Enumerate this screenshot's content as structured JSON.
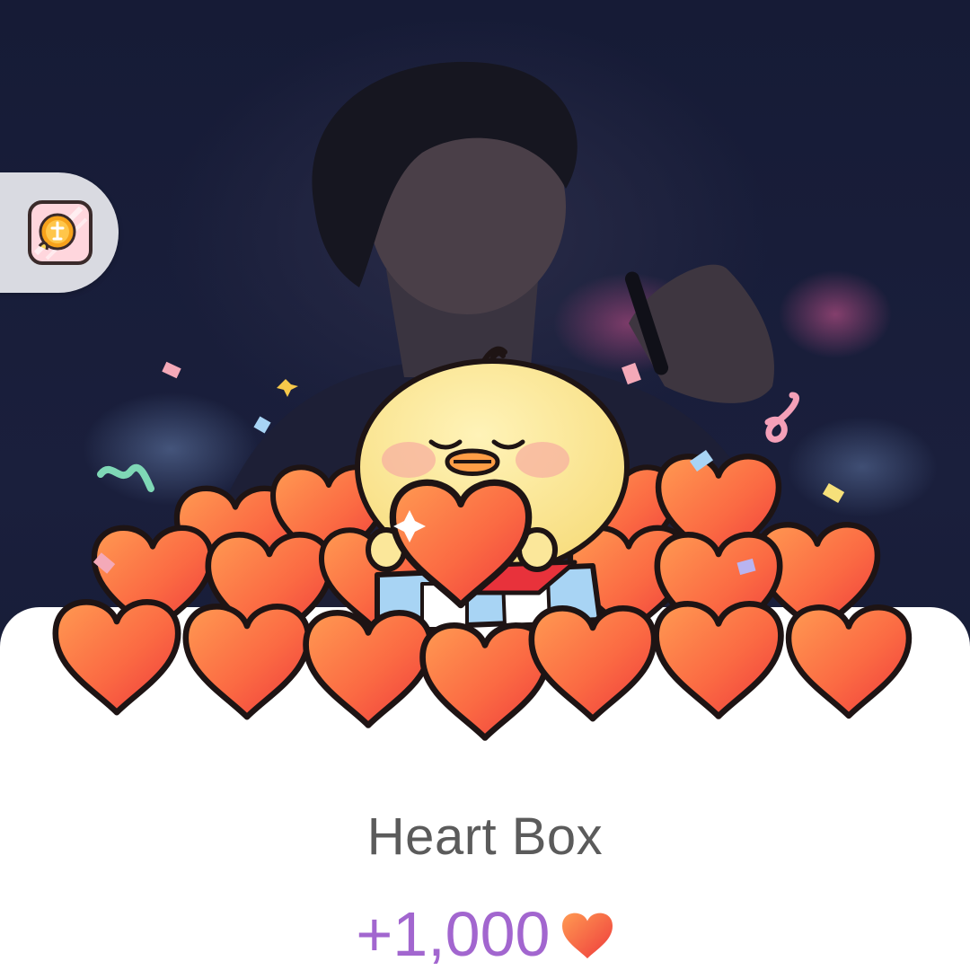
{
  "reward_card": {
    "title": "Heart Box",
    "amount": "+1,000",
    "currency_icon": "heart-icon"
  },
  "side_badge": {
    "icon": "hamster-coin-icon"
  },
  "background": {
    "description_icon": "live-video-frame"
  },
  "colors": {
    "amount": "#a266cf",
    "title": "#5b5b5b",
    "heart_top": "#ff8a4c",
    "heart_bottom": "#f2413f",
    "chick": "#fbe79a"
  }
}
